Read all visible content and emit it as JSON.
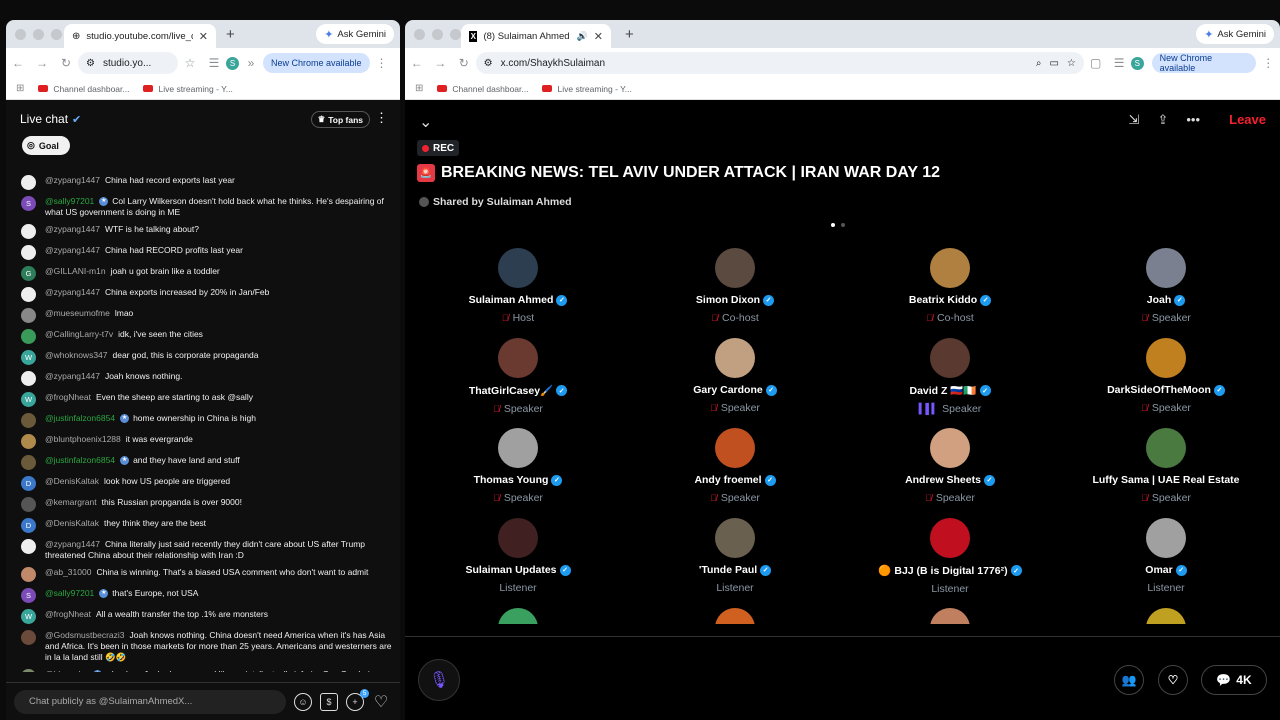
{
  "left_window": {
    "tab_title": "studio.youtube.com/live_cha",
    "ask_gemini": "Ask Gemini",
    "url": "studio.yo...",
    "new_chrome": "New Chrome available",
    "profile_initial": "S",
    "bookmarks": [
      "Channel dashboar...",
      "Live streaming - Y..."
    ],
    "chat_title": "Live chat",
    "top_fans": "Top fans",
    "goal": "Goal",
    "input_placeholder": "Chat publicly as @SulaimanAhmedX...",
    "gift_count": "5",
    "messages": [
      {
        "author": "@zypang1447",
        "text": "China had record exports last year",
        "color": "#eee",
        "initial": "",
        "member": false,
        "badge": false
      },
      {
        "author": "@sally97201",
        "text": "Col Larry Wilkerson doesn't hold back what he thinks. He's despairing of what US government is doing in ME",
        "color": "#7b4bb8",
        "initial": "S",
        "member": true,
        "badge": true
      },
      {
        "author": "@zypang1447",
        "text": "WTF is he talking about?",
        "color": "#eee",
        "initial": "",
        "member": false,
        "badge": false
      },
      {
        "author": "@zypang1447",
        "text": "China had RECORD profits last year",
        "color": "#eee",
        "initial": "",
        "member": false,
        "badge": false
      },
      {
        "author": "@GILLANI-m1n",
        "text": "joah u got brain like a toddler",
        "color": "#2e7d5a",
        "initial": "G",
        "member": false,
        "badge": false
      },
      {
        "author": "@zypang1447",
        "text": "China exports increased by 20% in Jan/Feb",
        "color": "#eee",
        "initial": "",
        "member": false,
        "badge": false
      },
      {
        "author": "@mueseumofme",
        "text": "lmao",
        "color": "#888",
        "initial": "",
        "member": false,
        "badge": false
      },
      {
        "author": "@CallingLarry-t7v",
        "text": "idk, i've seen the cities",
        "color": "#3a9a5a",
        "initial": "",
        "member": false,
        "badge": false
      },
      {
        "author": "@whoknows347",
        "text": "dear god, this is corporate propaganda",
        "color": "#3aa69b",
        "initial": "W",
        "member": false,
        "badge": false
      },
      {
        "author": "@zypang1447",
        "text": "Joah knows nothing.",
        "color": "#eee",
        "initial": "",
        "member": false,
        "badge": false
      },
      {
        "author": "@frogNheat",
        "text": "Even the sheep are starting to ask @sally",
        "color": "#3aa69b",
        "initial": "W",
        "member": false,
        "badge": false
      },
      {
        "author": "@justinfalzon6854",
        "text": "home ownership in China is high",
        "color": "#6a5a3a",
        "initial": "",
        "member": true,
        "badge": true
      },
      {
        "author": "@bluntphoenix1288",
        "text": "it was evergrande",
        "color": "#b08a4a",
        "initial": "",
        "member": false,
        "badge": false
      },
      {
        "author": "@justinfalzon6854",
        "text": "and they have land and stuff",
        "color": "#6a5a3a",
        "initial": "",
        "member": true,
        "badge": true
      },
      {
        "author": "@DenisKaltak",
        "text": "look how US people are triggered",
        "color": "#3b78c9",
        "initial": "D",
        "member": false,
        "badge": false
      },
      {
        "author": "@kemargrant",
        "text": "this Russian propganda is over 9000!",
        "color": "#555",
        "initial": "",
        "member": false,
        "badge": false
      },
      {
        "author": "@DenisKaltak",
        "text": "they think they are the best",
        "color": "#3b78c9",
        "initial": "D",
        "member": false,
        "badge": false
      },
      {
        "author": "@zypang1447",
        "text": "China literally just said recently they didn't care about US after Trump threatened China about their relationship with Iran :D",
        "color": "#eee",
        "initial": "",
        "member": false,
        "badge": false
      },
      {
        "author": "@ab_31000",
        "text": "China is winning. That's a biased USA comment who don't want to admit",
        "color": "#c08a6a",
        "initial": "",
        "member": false,
        "badge": false
      },
      {
        "author": "@sally97201",
        "text": "that's Europe, not USA",
        "color": "#7b4bb8",
        "initial": "S",
        "member": true,
        "badge": true
      },
      {
        "author": "@frogNheat",
        "text": "All a wealth transfer the top .1% are monsters",
        "color": "#3aa69b",
        "initial": "W",
        "member": false,
        "badge": false
      },
      {
        "author": "@Godsmustbecrazi3",
        "text": "Joah knows nothing. China doesn't need America when it's has Asia and Africa. It's been in those markets for more than 25 years. Americans and westerners are in la la land still 🤣🤣",
        "color": "#6a4a3a",
        "initial": "",
        "member": false,
        "badge": false
      },
      {
        "author": "@bl__ayke",
        "text": "why does Joah always sound like an intellectually inferior Gay Guy being outmatched by an intellectually superior straight guy?",
        "color": "#7a8a6a",
        "initial": "",
        "member": false,
        "badge": true
      }
    ]
  },
  "right_window": {
    "tab_title": "(8) Sulaiman Ahmed (@Sh",
    "ask_gemini": "Ask Gemini",
    "url": "x.com/ShaykhSulaiman",
    "new_chrome": "New Chrome available",
    "profile_initial": "S",
    "bookmarks": [
      "Channel dashboar...",
      "Live streaming - Y..."
    ],
    "leave": "Leave",
    "rec": "REC",
    "title": "BREAKING NEWS: TEL AVIV UNDER ATTACK | IRAN WAR DAY 12",
    "shared_by": "Shared by Sulaiman Ahmed",
    "listeners_count": "4K",
    "participants": [
      {
        "name": "Sulaiman Ahmed",
        "role": "Host",
        "verified": true,
        "color": "#2c3e50",
        "state": "muted"
      },
      {
        "name": "Simon Dixon",
        "role": "Co-host",
        "verified": true,
        "color": "#5a4a40",
        "state": "muted"
      },
      {
        "name": "Beatrix Kiddo",
        "role": "Co-host",
        "verified": true,
        "color": "#b08040",
        "state": "muted"
      },
      {
        "name": "Joah",
        "role": "Speaker",
        "verified": true,
        "color": "#7a8090",
        "state": "muted"
      },
      {
        "name": "ThatGirlCasey🖌️",
        "role": "Speaker",
        "verified": true,
        "color": "#6a3a30",
        "state": "muted"
      },
      {
        "name": "Gary Cardone",
        "role": "Speaker",
        "verified": true,
        "color": "#c0a080",
        "state": "muted"
      },
      {
        "name": "David Z 🇷🇺🇮🇪",
        "role": "Speaker",
        "verified": true,
        "color": "#5a3a30",
        "state": "speaking"
      },
      {
        "name": "DarkSideOfTheMoon",
        "role": "Speaker",
        "verified": true,
        "color": "#c08020",
        "state": "muted"
      },
      {
        "name": "Thomas Young",
        "role": "Speaker",
        "verified": true,
        "color": "#a0a0a0",
        "state": "muted"
      },
      {
        "name": "Andy froemel",
        "role": "Speaker",
        "verified": true,
        "color": "#c05020",
        "state": "muted"
      },
      {
        "name": "Andrew Sheets",
        "role": "Speaker",
        "verified": true,
        "color": "#d0a080",
        "state": "muted"
      },
      {
        "name": "Luffy Sama | UAE Real Estate",
        "role": "Speaker",
        "verified": false,
        "color": "#4a7a40",
        "state": "muted"
      },
      {
        "name": "Sulaiman Updates",
        "role": "Listener",
        "verified": true,
        "color": "#402020",
        "state": "none"
      },
      {
        "name": "'Tunde Paul",
        "role": "Listener",
        "verified": true,
        "color": "#6a6050",
        "state": "none"
      },
      {
        "name": "🟠 BJJ (B is Digital 1776²)",
        "role": "Listener",
        "verified": true,
        "color": "#c01020",
        "state": "none"
      },
      {
        "name": "Omar",
        "role": "Listener",
        "verified": true,
        "color": "#a0a0a0",
        "state": "none"
      }
    ],
    "peek_avatars": [
      "#3aa060",
      "#d06020",
      "#c08060",
      "#c0a020"
    ]
  },
  "colors": {
    "x_verified": "#1d9bf0",
    "leave_red": "#f4212e",
    "yt_member_green": "#2ba640",
    "spaces_purple": "#7856ff"
  }
}
